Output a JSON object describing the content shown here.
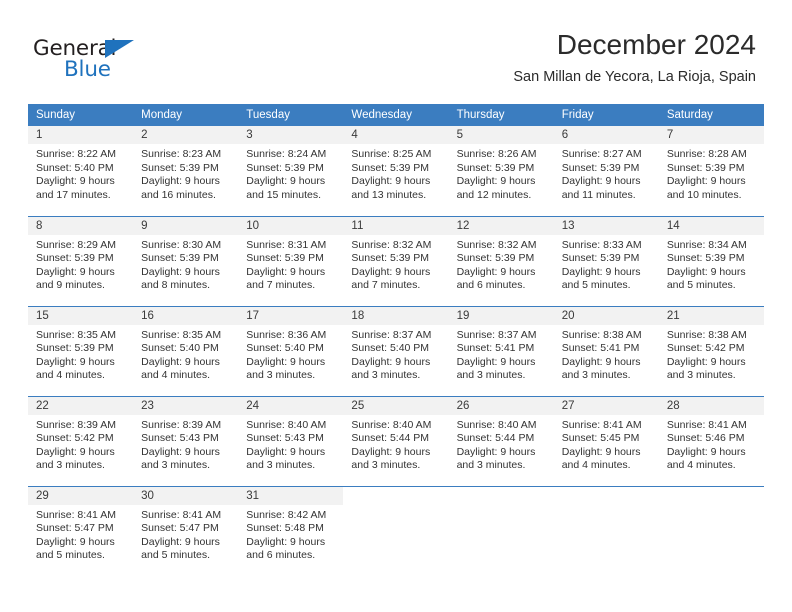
{
  "brand": {
    "name_part1": "General",
    "name_part2": "Blue",
    "accent_color": "#1f72bd",
    "triangle_icon": "triangle-icon"
  },
  "header": {
    "title": "December 2024",
    "subtitle": "San Millan de Yecora, La Rioja, Spain"
  },
  "calendar": {
    "header_bg": "#3b7dc0",
    "daynum_bg": "#f2f2f2",
    "weekdays": [
      "Sunday",
      "Monday",
      "Tuesday",
      "Wednesday",
      "Thursday",
      "Friday",
      "Saturday"
    ],
    "weeks": [
      [
        {
          "day": "1",
          "sunrise": "Sunrise: 8:22 AM",
          "sunset": "Sunset: 5:40 PM",
          "daylight1": "Daylight: 9 hours",
          "daylight2": "and 17 minutes."
        },
        {
          "day": "2",
          "sunrise": "Sunrise: 8:23 AM",
          "sunset": "Sunset: 5:39 PM",
          "daylight1": "Daylight: 9 hours",
          "daylight2": "and 16 minutes."
        },
        {
          "day": "3",
          "sunrise": "Sunrise: 8:24 AM",
          "sunset": "Sunset: 5:39 PM",
          "daylight1": "Daylight: 9 hours",
          "daylight2": "and 15 minutes."
        },
        {
          "day": "4",
          "sunrise": "Sunrise: 8:25 AM",
          "sunset": "Sunset: 5:39 PM",
          "daylight1": "Daylight: 9 hours",
          "daylight2": "and 13 minutes."
        },
        {
          "day": "5",
          "sunrise": "Sunrise: 8:26 AM",
          "sunset": "Sunset: 5:39 PM",
          "daylight1": "Daylight: 9 hours",
          "daylight2": "and 12 minutes."
        },
        {
          "day": "6",
          "sunrise": "Sunrise: 8:27 AM",
          "sunset": "Sunset: 5:39 PM",
          "daylight1": "Daylight: 9 hours",
          "daylight2": "and 11 minutes."
        },
        {
          "day": "7",
          "sunrise": "Sunrise: 8:28 AM",
          "sunset": "Sunset: 5:39 PM",
          "daylight1": "Daylight: 9 hours",
          "daylight2": "and 10 minutes."
        }
      ],
      [
        {
          "day": "8",
          "sunrise": "Sunrise: 8:29 AM",
          "sunset": "Sunset: 5:39 PM",
          "daylight1": "Daylight: 9 hours",
          "daylight2": "and 9 minutes."
        },
        {
          "day": "9",
          "sunrise": "Sunrise: 8:30 AM",
          "sunset": "Sunset: 5:39 PM",
          "daylight1": "Daylight: 9 hours",
          "daylight2": "and 8 minutes."
        },
        {
          "day": "10",
          "sunrise": "Sunrise: 8:31 AM",
          "sunset": "Sunset: 5:39 PM",
          "daylight1": "Daylight: 9 hours",
          "daylight2": "and 7 minutes."
        },
        {
          "day": "11",
          "sunrise": "Sunrise: 8:32 AM",
          "sunset": "Sunset: 5:39 PM",
          "daylight1": "Daylight: 9 hours",
          "daylight2": "and 7 minutes."
        },
        {
          "day": "12",
          "sunrise": "Sunrise: 8:32 AM",
          "sunset": "Sunset: 5:39 PM",
          "daylight1": "Daylight: 9 hours",
          "daylight2": "and 6 minutes."
        },
        {
          "day": "13",
          "sunrise": "Sunrise: 8:33 AM",
          "sunset": "Sunset: 5:39 PM",
          "daylight1": "Daylight: 9 hours",
          "daylight2": "and 5 minutes."
        },
        {
          "day": "14",
          "sunrise": "Sunrise: 8:34 AM",
          "sunset": "Sunset: 5:39 PM",
          "daylight1": "Daylight: 9 hours",
          "daylight2": "and 5 minutes."
        }
      ],
      [
        {
          "day": "15",
          "sunrise": "Sunrise: 8:35 AM",
          "sunset": "Sunset: 5:39 PM",
          "daylight1": "Daylight: 9 hours",
          "daylight2": "and 4 minutes."
        },
        {
          "day": "16",
          "sunrise": "Sunrise: 8:35 AM",
          "sunset": "Sunset: 5:40 PM",
          "daylight1": "Daylight: 9 hours",
          "daylight2": "and 4 minutes."
        },
        {
          "day": "17",
          "sunrise": "Sunrise: 8:36 AM",
          "sunset": "Sunset: 5:40 PM",
          "daylight1": "Daylight: 9 hours",
          "daylight2": "and 3 minutes."
        },
        {
          "day": "18",
          "sunrise": "Sunrise: 8:37 AM",
          "sunset": "Sunset: 5:40 PM",
          "daylight1": "Daylight: 9 hours",
          "daylight2": "and 3 minutes."
        },
        {
          "day": "19",
          "sunrise": "Sunrise: 8:37 AM",
          "sunset": "Sunset: 5:41 PM",
          "daylight1": "Daylight: 9 hours",
          "daylight2": "and 3 minutes."
        },
        {
          "day": "20",
          "sunrise": "Sunrise: 8:38 AM",
          "sunset": "Sunset: 5:41 PM",
          "daylight1": "Daylight: 9 hours",
          "daylight2": "and 3 minutes."
        },
        {
          "day": "21",
          "sunrise": "Sunrise: 8:38 AM",
          "sunset": "Sunset: 5:42 PM",
          "daylight1": "Daylight: 9 hours",
          "daylight2": "and 3 minutes."
        }
      ],
      [
        {
          "day": "22",
          "sunrise": "Sunrise: 8:39 AM",
          "sunset": "Sunset: 5:42 PM",
          "daylight1": "Daylight: 9 hours",
          "daylight2": "and 3 minutes."
        },
        {
          "day": "23",
          "sunrise": "Sunrise: 8:39 AM",
          "sunset": "Sunset: 5:43 PM",
          "daylight1": "Daylight: 9 hours",
          "daylight2": "and 3 minutes."
        },
        {
          "day": "24",
          "sunrise": "Sunrise: 8:40 AM",
          "sunset": "Sunset: 5:43 PM",
          "daylight1": "Daylight: 9 hours",
          "daylight2": "and 3 minutes."
        },
        {
          "day": "25",
          "sunrise": "Sunrise: 8:40 AM",
          "sunset": "Sunset: 5:44 PM",
          "daylight1": "Daylight: 9 hours",
          "daylight2": "and 3 minutes."
        },
        {
          "day": "26",
          "sunrise": "Sunrise: 8:40 AM",
          "sunset": "Sunset: 5:44 PM",
          "daylight1": "Daylight: 9 hours",
          "daylight2": "and 3 minutes."
        },
        {
          "day": "27",
          "sunrise": "Sunrise: 8:41 AM",
          "sunset": "Sunset: 5:45 PM",
          "daylight1": "Daylight: 9 hours",
          "daylight2": "and 4 minutes."
        },
        {
          "day": "28",
          "sunrise": "Sunrise: 8:41 AM",
          "sunset": "Sunset: 5:46 PM",
          "daylight1": "Daylight: 9 hours",
          "daylight2": "and 4 minutes."
        }
      ],
      [
        {
          "day": "29",
          "sunrise": "Sunrise: 8:41 AM",
          "sunset": "Sunset: 5:47 PM",
          "daylight1": "Daylight: 9 hours",
          "daylight2": "and 5 minutes."
        },
        {
          "day": "30",
          "sunrise": "Sunrise: 8:41 AM",
          "sunset": "Sunset: 5:47 PM",
          "daylight1": "Daylight: 9 hours",
          "daylight2": "and 5 minutes."
        },
        {
          "day": "31",
          "sunrise": "Sunrise: 8:42 AM",
          "sunset": "Sunset: 5:48 PM",
          "daylight1": "Daylight: 9 hours",
          "daylight2": "and 6 minutes."
        },
        {
          "day": "",
          "sunrise": "",
          "sunset": "",
          "daylight1": "",
          "daylight2": ""
        },
        {
          "day": "",
          "sunrise": "",
          "sunset": "",
          "daylight1": "",
          "daylight2": ""
        },
        {
          "day": "",
          "sunrise": "",
          "sunset": "",
          "daylight1": "",
          "daylight2": ""
        },
        {
          "day": "",
          "sunrise": "",
          "sunset": "",
          "daylight1": "",
          "daylight2": ""
        }
      ]
    ]
  }
}
